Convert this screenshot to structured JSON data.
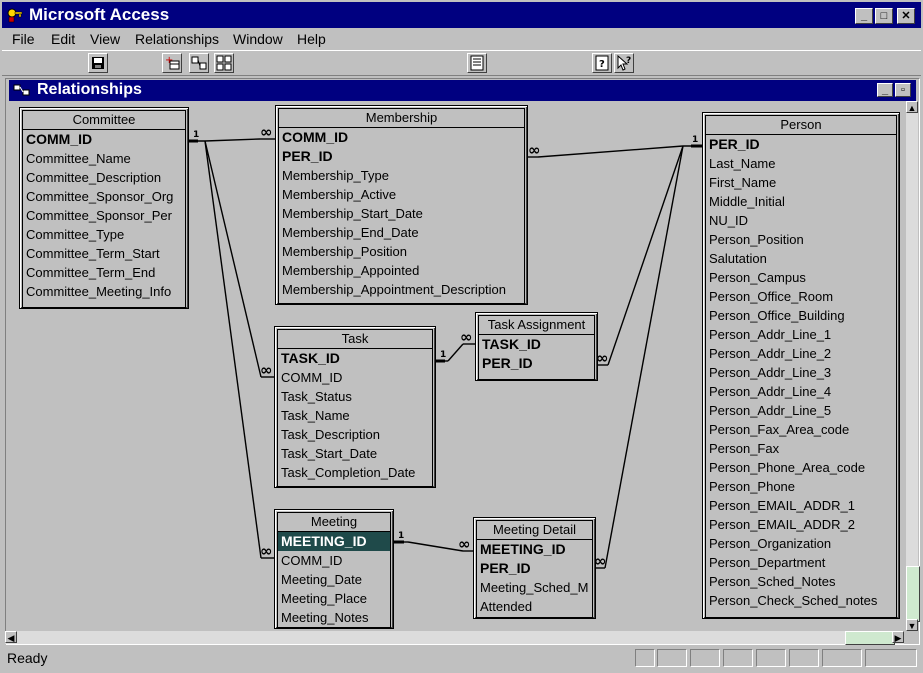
{
  "app": {
    "title": "Microsoft Access",
    "menu": [
      "File",
      "Edit",
      "View",
      "Relationships",
      "Window",
      "Help"
    ]
  },
  "toolbar": {
    "buttons": [
      "save-icon",
      "show-table-icon",
      "show-direct-icon",
      "show-all-icon",
      "properties-icon",
      "help-icon",
      "whats-this-icon"
    ]
  },
  "child_window": {
    "title": "Relationships"
  },
  "tables": {
    "committee": {
      "name": "Committee",
      "fields": [
        "COMM_ID",
        "Committee_Name",
        "Committee_Description",
        "Committee_Sponsor_Org",
        "Committee_Sponsor_Per",
        "Committee_Type",
        "Committee_Term_Start",
        "Committee_Term_End",
        "Committee_Meeting_Info"
      ]
    },
    "membership": {
      "name": "Membership",
      "fields": [
        "COMM_ID",
        "PER_ID",
        "Membership_Type",
        "Membership_Active",
        "Membership_Start_Date",
        "Membership_End_Date",
        "Membership_Position",
        "Membership_Appointed",
        "Membership_Appointment_Description"
      ]
    },
    "person": {
      "name": "Person",
      "fields": [
        "PER_ID",
        "Last_Name",
        "First_Name",
        "Middle_Initial",
        "NU_ID",
        "Person_Position",
        "Salutation",
        "Person_Campus",
        "Person_Office_Room",
        "Person_Office_Building",
        "Person_Addr_Line_1",
        "Person_Addr_Line_2",
        "Person_Addr_Line_3",
        "Person_Addr_Line_4",
        "Person_Addr_Line_5",
        "Person_Fax_Area_code",
        "Person_Fax",
        "Person_Phone_Area_code",
        "Person_Phone",
        "Person_EMAIL_ADDR_1",
        "Person_EMAIL_ADDR_2",
        "Person_Organization",
        "Person_Department",
        "Person_Sched_Notes",
        "Person_Check_Sched_notes"
      ]
    },
    "task": {
      "name": "Task",
      "fields": [
        "TASK_ID",
        "COMM_ID",
        "Task_Status",
        "Task_Name",
        "Task_Description",
        "Task_Start_Date",
        "Task_Completion_Date"
      ]
    },
    "task_assignment": {
      "name": "Task Assignment",
      "fields": [
        "TASK_ID",
        "PER_ID"
      ]
    },
    "meeting": {
      "name": "Meeting",
      "fields": [
        "MEETING_ID",
        "COMM_ID",
        "Meeting_Date",
        "Meeting_Place",
        "Meeting_Notes"
      ],
      "selected_field": "MEETING_ID"
    },
    "meeting_detail": {
      "name": "Meeting Detail",
      "fields": [
        "MEETING_ID",
        "PER_ID",
        "Meeting_Sched_M",
        "Attended"
      ]
    }
  },
  "relationships": {
    "one_label": "1",
    "many_label": "∞"
  },
  "status": {
    "text": "Ready"
  }
}
